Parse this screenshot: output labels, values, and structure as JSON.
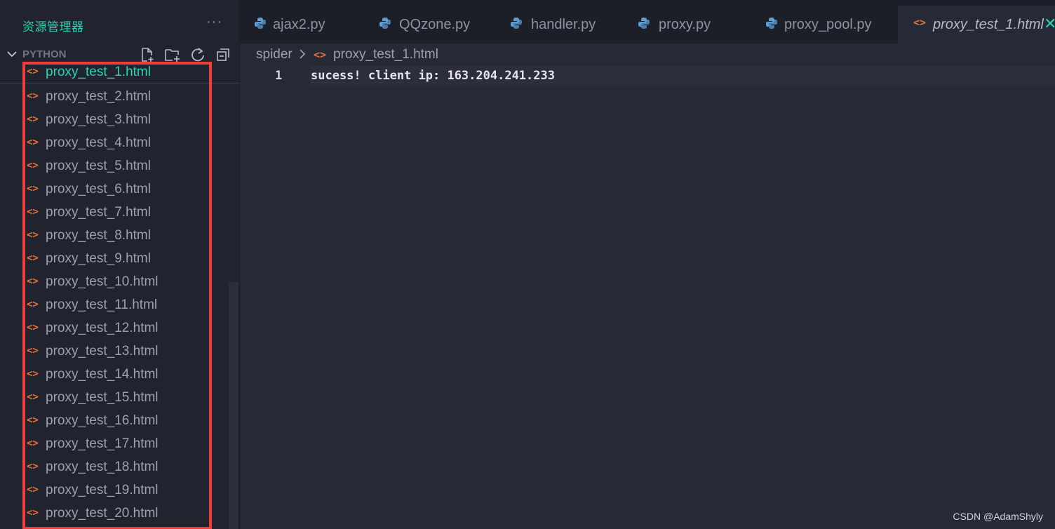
{
  "explorer": {
    "title": "资源管理器",
    "more": "···",
    "section_label": "PYTHON"
  },
  "files": [
    {
      "name": "proxy_test_1.html",
      "icon": "html-file-icon"
    },
    {
      "name": "proxy_test_2.html",
      "icon": "html-file-icon"
    },
    {
      "name": "proxy_test_3.html",
      "icon": "html-file-icon"
    },
    {
      "name": "proxy_test_4.html",
      "icon": "html-file-icon"
    },
    {
      "name": "proxy_test_5.html",
      "icon": "html-file-icon"
    },
    {
      "name": "proxy_test_6.html",
      "icon": "html-file-icon"
    },
    {
      "name": "proxy_test_7.html",
      "icon": "html-file-icon"
    },
    {
      "name": "proxy_test_8.html",
      "icon": "html-file-icon"
    },
    {
      "name": "proxy_test_9.html",
      "icon": "html-file-icon"
    },
    {
      "name": "proxy_test_10.html",
      "icon": "html-file-icon"
    },
    {
      "name": "proxy_test_11.html",
      "icon": "html-file-icon"
    },
    {
      "name": "proxy_test_12.html",
      "icon": "html-file-icon"
    },
    {
      "name": "proxy_test_13.html",
      "icon": "html-file-icon"
    },
    {
      "name": "proxy_test_14.html",
      "icon": "html-file-icon"
    },
    {
      "name": "proxy_test_15.html",
      "icon": "html-file-icon"
    },
    {
      "name": "proxy_test_16.html",
      "icon": "html-file-icon"
    },
    {
      "name": "proxy_test_17.html",
      "icon": "html-file-icon"
    },
    {
      "name": "proxy_test_18.html",
      "icon": "html-file-icon"
    },
    {
      "name": "proxy_test_19.html",
      "icon": "html-file-icon"
    },
    {
      "name": "proxy_test_20.html",
      "icon": "html-file-icon"
    }
  ],
  "tabs": [
    {
      "label": "ajax2.py",
      "icon": "python-icon"
    },
    {
      "label": "QQzone.py",
      "icon": "python-icon"
    },
    {
      "label": "handler.py",
      "icon": "python-icon"
    },
    {
      "label": "proxy.py",
      "icon": "python-icon"
    },
    {
      "label": "proxy_pool.py",
      "icon": "python-icon"
    },
    {
      "label": "proxy_test_1.html",
      "icon": "html-file-icon",
      "active": true
    }
  ],
  "tab_close": "✕",
  "breadcrumb": {
    "root": "spider",
    "file": "proxy_test_1.html"
  },
  "editor": {
    "line_number": "1",
    "line_text": "sucess! client ip: 163.204.241.233"
  },
  "watermark": "CSDN @AdamShyly",
  "colors": {
    "accent": "#2bd3b5",
    "html_icon": "#e8703a",
    "python_icon": "#5b9fd6",
    "highlight_box": "#f23d3d"
  }
}
